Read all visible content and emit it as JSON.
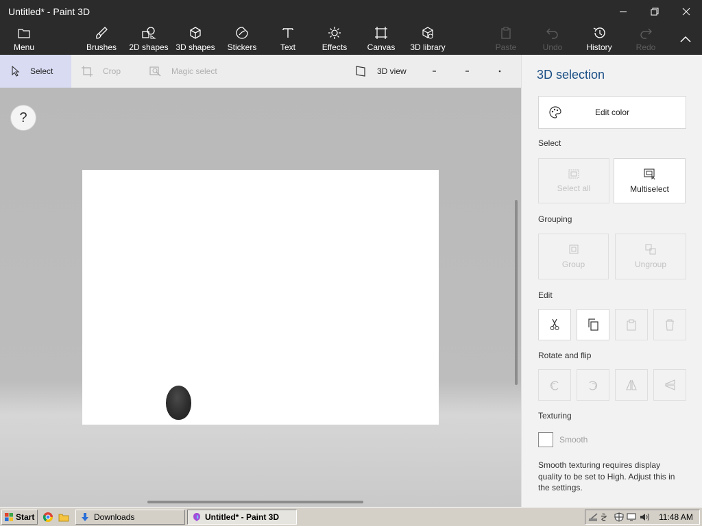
{
  "window": {
    "title": "Untitled* - Paint 3D"
  },
  "ribbon": {
    "menu": "Menu",
    "tools": [
      {
        "id": "brushes",
        "label": "Brushes",
        "icon": "brush-icon"
      },
      {
        "id": "2d-shapes",
        "label": "2D shapes",
        "icon": "2d-shapes-icon"
      },
      {
        "id": "3d-shapes",
        "label": "3D shapes",
        "icon": "cube-icon"
      },
      {
        "id": "stickers",
        "label": "Stickers",
        "icon": "sticker-icon"
      },
      {
        "id": "text",
        "label": "Text",
        "icon": "text-icon"
      },
      {
        "id": "effects",
        "label": "Effects",
        "icon": "sun-icon"
      },
      {
        "id": "canvas",
        "label": "Canvas",
        "icon": "canvas-icon"
      },
      {
        "id": "3d-library",
        "label": "3D library",
        "icon": "library-icon"
      }
    ],
    "paste": "Paste",
    "undo": "Undo",
    "history": "History",
    "redo": "Redo"
  },
  "toolbar": {
    "select": "Select",
    "crop": "Crop",
    "magic_select": "Magic select",
    "view_3d": "3D view"
  },
  "workspace": {
    "help": "?"
  },
  "panel": {
    "title": "3D selection",
    "edit_color": "Edit color",
    "select_section": "Select",
    "select_all": "Select all",
    "multiselect": "Multiselect",
    "grouping_section": "Grouping",
    "group": "Group",
    "ungroup": "Ungroup",
    "edit_section": "Edit",
    "rotate_section": "Rotate and flip",
    "texturing_section": "Texturing",
    "smooth": "Smooth",
    "smooth_checked": false,
    "smooth_note": "Smooth texturing requires display quality to be set to High. Adjust this in the settings."
  },
  "taskbar": {
    "start": "Start",
    "downloads": "Downloads",
    "active_window": "Untitled* - Paint 3D",
    "clock": "11:48 AM"
  },
  "colors": {
    "titlebar": "#2b2b2b",
    "panel_title": "#1a4e85",
    "select_highlight": "#d8dbf2"
  }
}
